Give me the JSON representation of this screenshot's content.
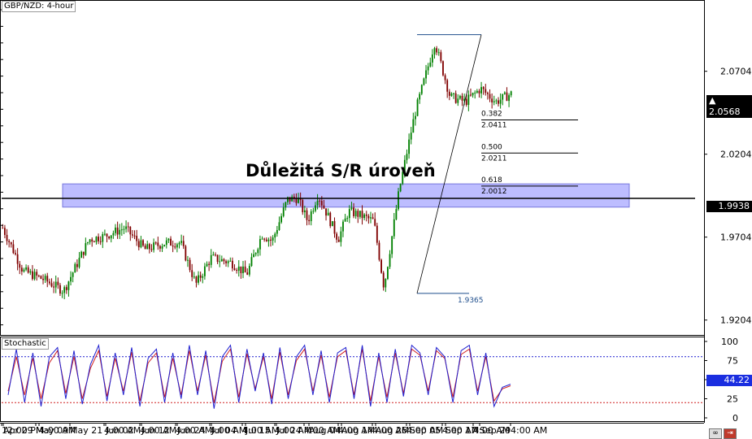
{
  "window": {
    "title": "GBP/NZD: 4-hour",
    "indicator_title": "Stochastic"
  },
  "annotation": {
    "title": "Důležitá S/R úroveň"
  },
  "badges": {
    "current_price": "▲ 2.0568",
    "level_price": "1.9938",
    "stoch_value": "44.22"
  },
  "fib": {
    "high_value": 2.0925,
    "low_value": 1.9365,
    "low_label": "1.9365",
    "levels": [
      {
        "ratio": "0.382",
        "value": "2.0411"
      },
      {
        "ratio": "0.500",
        "value": "2.0211"
      },
      {
        "ratio": "0.618",
        "value": "2.0012"
      }
    ]
  },
  "colors": {
    "bull_candle": "#008000",
    "bear_candle": "#800000",
    "sr_zone": "#9999ff",
    "stoch_main": "#2020d0",
    "stoch_signal": "#d02020",
    "level_line": "#000000",
    "fib_line": "#1f4e8c"
  },
  "chart_data": [
    {
      "type": "candlestick",
      "title": "GBP/NZD: 4-hour",
      "ylim": [
        1.9124,
        2.1124
      ],
      "y_ticks": [
        "2.0704",
        "2.0204",
        "1.9704",
        "1.9204"
      ],
      "x_ticks": [
        "12:00 PM",
        "Apr 29",
        "4:00 AM",
        "May 09",
        "May 21",
        "4:00 AM",
        "Jun 02",
        "4:00 AM",
        "Jun 12",
        "4:00 AM",
        "Jun 24",
        "4:00 AM",
        "Jul 04",
        "4:00 AM",
        "Jul 15",
        "4:00 AM",
        "Jul 24",
        "4:00 AM",
        "Aug 04",
        "4:00 AM",
        "Aug 14",
        "4:00 AM",
        "Aug 26",
        "4:00 AM",
        "Sep 05",
        "4:00 AM",
        "Sep 17",
        "4:00 AM",
        "Sep 29",
        "4:00 AM"
      ],
      "horizontal_level": 1.9938,
      "sr_zone": [
        1.9885,
        2.0025
      ],
      "series": [
        {
          "name": "close",
          "x_points": [
            0,
            0.04,
            0.08,
            0.12,
            0.17,
            0.2,
            0.24,
            0.28,
            0.32,
            0.35,
            0.38,
            0.41,
            0.45,
            0.48,
            0.51,
            0.53,
            0.56,
            0.58,
            0.6,
            0.62,
            0.64,
            0.66,
            0.68,
            0.7,
            0.73,
            0.75,
            0.78,
            0.81,
            0.85,
            0.88,
            0.91,
            0.94,
            0.97,
            1.0
          ],
          "values": [
            1.976,
            1.95,
            1.945,
            1.938,
            1.969,
            1.971,
            1.976,
            1.963,
            1.967,
            1.967,
            1.942,
            1.958,
            1.955,
            1.948,
            1.972,
            1.968,
            1.993,
            1.994,
            1.98,
            1.996,
            1.983,
            1.969,
            1.986,
            1.984,
            1.98,
            1.94,
            1.999,
            2.044,
            2.088,
            2.055,
            2.052,
            2.06,
            2.052,
            2.0568
          ]
        }
      ]
    },
    {
      "type": "line",
      "title": "Stochastic",
      "ylim": [
        0,
        100
      ],
      "y_ticks": [
        "100",
        "75",
        "50",
        "25",
        "0"
      ],
      "reference_lines": [
        80,
        20
      ],
      "series": [
        {
          "name": "%K",
          "values": [
            30,
            90,
            20,
            85,
            15,
            80,
            92,
            25,
            88,
            18,
            70,
            95,
            22,
            85,
            30,
            92,
            15,
            78,
            90,
            20,
            85,
            25,
            95,
            30,
            88,
            12,
            80,
            95,
            20,
            90,
            35,
            85,
            18,
            92,
            25,
            80,
            95,
            30,
            88,
            20,
            85,
            92,
            25,
            95,
            15,
            85,
            20,
            90,
            28,
            95,
            85,
            30,
            92,
            80,
            20,
            88,
            95,
            30,
            85,
            15,
            40,
            44
          ]
        },
        {
          "name": "%D",
          "values": [
            35,
            80,
            30,
            78,
            25,
            72,
            88,
            32,
            80,
            25,
            65,
            88,
            28,
            78,
            35,
            86,
            22,
            72,
            85,
            27,
            78,
            30,
            88,
            35,
            82,
            20,
            74,
            90,
            27,
            84,
            38,
            80,
            25,
            86,
            30,
            75,
            90,
            35,
            82,
            27,
            80,
            88,
            30,
            90,
            22,
            80,
            27,
            85,
            32,
            90,
            82,
            35,
            88,
            78,
            27,
            83,
            90,
            35,
            80,
            22,
            38,
            42
          ]
        }
      ]
    }
  ]
}
